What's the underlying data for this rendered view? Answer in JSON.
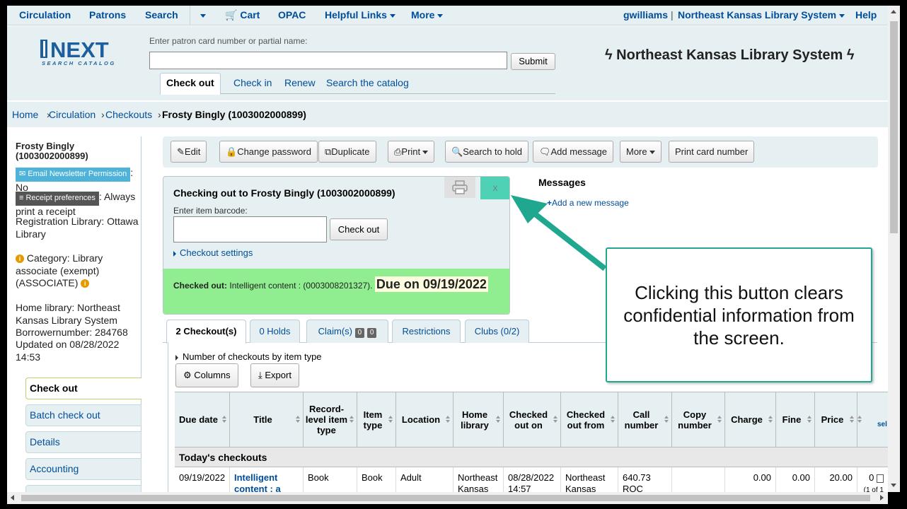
{
  "nav": {
    "items": [
      "Circulation",
      "Patrons",
      "Search"
    ],
    "cart": "Cart",
    "opac": "OPAC",
    "helpful_links": "Helpful Links",
    "more": "More",
    "user": "gwilliams",
    "library": "Northeast Kansas Library System",
    "help": "Help"
  },
  "header": {
    "logo_text": "NEXT",
    "logo_sub": "SEARCH CATALOG",
    "patron_label": "Enter patron card number or partial name:",
    "patron_value": "",
    "submit": "Submit",
    "library_title": "Northeast Kansas Library System",
    "quick_tabs": [
      "Check out",
      "Check in",
      "Renew",
      "Search the catalog"
    ]
  },
  "breadcrumb": {
    "home": "Home",
    "circulation": "Circulation",
    "checkouts": "Checkouts",
    "current": "Frosty Bingly (1003002000899)"
  },
  "sidebar": {
    "patron_name": "Frosty Bingly",
    "patron_card": "(1003002000899)",
    "email_newsletter_label": "Email Newsletter Permission",
    "email_newsletter_value": ": No",
    "receipt_label": "Receipt preferences",
    "receipt_value": ": Always print a receipt",
    "registration": "Registration Library: Ottawa Library",
    "category": "Category: Library associate (exempt) (ASSOCIATE)",
    "home_library": "Home library: Northeast Kansas Library System",
    "borrowernumber": "Borrowernumber: 284768",
    "updated": "Updated on 08/28/2022 14:53",
    "menu": [
      "Check out",
      "Batch check out",
      "Details",
      "Accounting"
    ]
  },
  "toolbar": {
    "edit": "Edit",
    "change_password": "Change password",
    "duplicate": "Duplicate",
    "print": "Print",
    "search_to_hold": "Search to hold",
    "add_message": "Add message",
    "more": "More",
    "print_card_number": "Print card number"
  },
  "checkout": {
    "title": "Checking out to Frosty Bingly (1003002000899)",
    "barcode_label": "Enter item barcode:",
    "barcode_value": "",
    "button": "Check out",
    "settings": "Checkout settings",
    "close_glyph": "x",
    "result_label": "Checked out:",
    "result_item": "Intelligent content : (0003008201327).",
    "due_text": "Due on 09/19/2022"
  },
  "messages": {
    "title": "Messages",
    "add": "Add a new message"
  },
  "tabs": [
    {
      "label": "2 Checkout(s)"
    },
    {
      "label": "0 Holds"
    },
    {
      "label": "Claim(s)",
      "badge1": "0",
      "badge2": "0"
    },
    {
      "label": "Restrictions"
    },
    {
      "label": "Clubs (0/2)"
    }
  ],
  "panel": {
    "num_by_type": "Number of checkouts by item type",
    "columns": "Columns",
    "export": "Export"
  },
  "table": {
    "headers": [
      "Due date",
      "Title",
      "Record-level item type",
      "Item type",
      "Location",
      "Home library",
      "Checked out on",
      "Checked out from",
      "Call number",
      "Copy number",
      "Charge",
      "Fine",
      "Price",
      ""
    ],
    "extra_header": "sel",
    "group_label": "Today's checkouts",
    "row": {
      "due_date": "09/19/2022",
      "title": "Intelligent content : a",
      "record_type": "Book",
      "item_type": "Book",
      "location": "Adult",
      "home_library": "Northeast Kansas",
      "checked_out_on": "08/28/2022 14:57",
      "checked_out_from": "Northeast Kansas",
      "call_number": "640.73 ROC",
      "copy_number": "",
      "charge": "0.00",
      "fine": "0.00",
      "price": "20.00",
      "renew": "0",
      "renew_sub": "(1 of 1"
    }
  },
  "callout": {
    "text": "Clicking this button clears confidential information from the screen."
  },
  "colors": {
    "accent": "#004d99",
    "success": "#90ee90",
    "highlight": "#4fd1b6",
    "callout_border": "#1fa88f"
  }
}
